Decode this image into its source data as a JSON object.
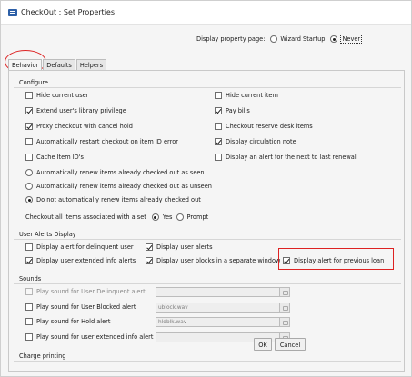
{
  "window": {
    "title": "CheckOut : Set Properties"
  },
  "display_property_page": {
    "label": "Display property page:",
    "options": [
      "Wizard Startup",
      "Never"
    ],
    "selected": "Never"
  },
  "tabs": [
    {
      "label": "Behavior",
      "active": true
    },
    {
      "label": "Defaults",
      "active": false
    },
    {
      "label": "Helpers",
      "active": false
    }
  ],
  "configure": {
    "title": "Configure",
    "left": [
      {
        "label": "Hide current user",
        "checked": false
      },
      {
        "label": "Extend user's library privilege",
        "checked": true
      },
      {
        "label": "Proxy checkout with cancel hold",
        "checked": true
      },
      {
        "label": "Automatically restart checkout on item ID error",
        "checked": false
      },
      {
        "label": "Cache Item ID's",
        "checked": false
      }
    ],
    "right": [
      {
        "label": "Hide current item",
        "checked": false
      },
      {
        "label": "Pay bills",
        "checked": true
      },
      {
        "label": "Checkout reserve desk items",
        "checked": false
      },
      {
        "label": "Display circulation note",
        "checked": true
      },
      {
        "label": "Display an alert for the next to last renewal",
        "checked": false
      }
    ],
    "renew_options": [
      {
        "label": "Automatically renew items already checked out as seen",
        "selected": false
      },
      {
        "label": "Automatically renew items already checked out as unseen",
        "selected": false
      },
      {
        "label": "Do not automatically renew items already checked out",
        "selected": true
      }
    ],
    "checkout_set": {
      "label": "Checkout all items associated with a set",
      "options": [
        "Yes",
        "Prompt"
      ],
      "selected": "Yes"
    }
  },
  "user_alerts": {
    "title": "User Alerts Display",
    "items": [
      {
        "label": "Display alert for delinquent user",
        "checked": false
      },
      {
        "label": "Display user alerts",
        "checked": true
      },
      {
        "label": "Display user extended info alerts",
        "checked": true
      },
      {
        "label": "Display user blocks in a separate window",
        "checked": true
      },
      {
        "label": "Display alert for previous loan",
        "checked": true
      }
    ]
  },
  "sounds": {
    "title": "Sounds",
    "items": [
      {
        "label": "Play sound for User Delinquent alert",
        "checked": false,
        "enabled": false,
        "file": ""
      },
      {
        "label": "Play sound for User Blocked alert",
        "checked": false,
        "enabled": true,
        "file": "ublock.wav"
      },
      {
        "label": "Play sound for Hold alert",
        "checked": false,
        "enabled": true,
        "file": "hldblk.wav"
      },
      {
        "label": "Play sound for user extended info alert",
        "checked": false,
        "enabled": true,
        "file": ""
      }
    ]
  },
  "charge_printing": {
    "title": "Charge printing"
  },
  "buttons": {
    "ok": "OK",
    "cancel": "Cancel"
  }
}
